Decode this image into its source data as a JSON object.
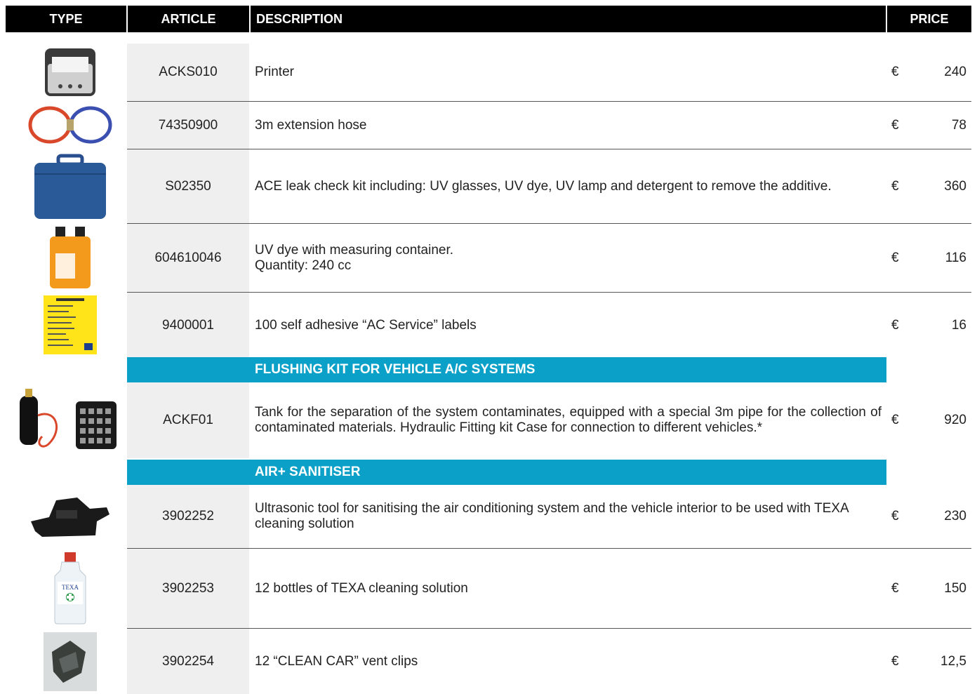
{
  "header": {
    "type": "TYPE",
    "article": "ARTICLE",
    "description": "DESCRIPTION",
    "price": "PRICE"
  },
  "rows": [
    {
      "article": "ACKS010",
      "desc": [
        "Printer"
      ],
      "currency": "€",
      "price": "240",
      "icon": "printer-icon"
    },
    {
      "article": "74350900",
      "desc": [
        "3m extension hose"
      ],
      "currency": "€",
      "price": "78",
      "icon": "hose-icon"
    },
    {
      "article": "S02350",
      "desc": [
        "ACE leak check kit including: UV glasses, UV dye, UV lamp and detergent to remove the additive."
      ],
      "currency": "€",
      "price": "360",
      "icon": "case-icon"
    },
    {
      "article": "604610046",
      "desc": [
        "UV dye with measuring container.",
        "Quantity: 240 cc"
      ],
      "currency": "€",
      "price": "116",
      "icon": "dye-bottle-icon"
    },
    {
      "article": "9400001",
      "desc": [
        "100 self adhesive “AC Service” labels"
      ],
      "currency": "€",
      "price": "16",
      "icon": "label-icon"
    },
    {
      "article": "ACKF01",
      "desc": [
        "Tank for the separation of the system contaminates, equipped with a special 3m pipe for the collection of contaminated materials. Hydraulic Fitting kit Case for connection to different vehicles.*"
      ],
      "currency": "€",
      "price": "920",
      "icon": "flushing-kit-icon"
    },
    {
      "article": "3902252",
      "desc": [
        "Ultrasonic tool for sanitising the air conditioning system and the vehicle interior to be used with TEXA cleaning solution"
      ],
      "currency": "€",
      "price": "230",
      "icon": "sanitiser-icon"
    },
    {
      "article": "3902253",
      "desc": [
        "12 bottles of TEXA cleaning solution"
      ],
      "currency": "€",
      "price": "150",
      "icon": "cleaning-bottle-icon"
    },
    {
      "article": "3902254",
      "desc": [
        "12 “CLEAN CAR” vent clips"
      ],
      "currency": "€",
      "price": "12,5",
      "icon": "vent-clip-icon"
    }
  ],
  "sections": [
    {
      "title": "FLUSHING KIT FOR VEHICLE A/C SYSTEMS"
    },
    {
      "title": "AIR+ SANITISER"
    }
  ],
  "bottle_brand": "TEXA",
  "colors": {
    "header_bg": "#000000",
    "section_bg": "#0aa0c8",
    "article_bg": "#efefef"
  }
}
